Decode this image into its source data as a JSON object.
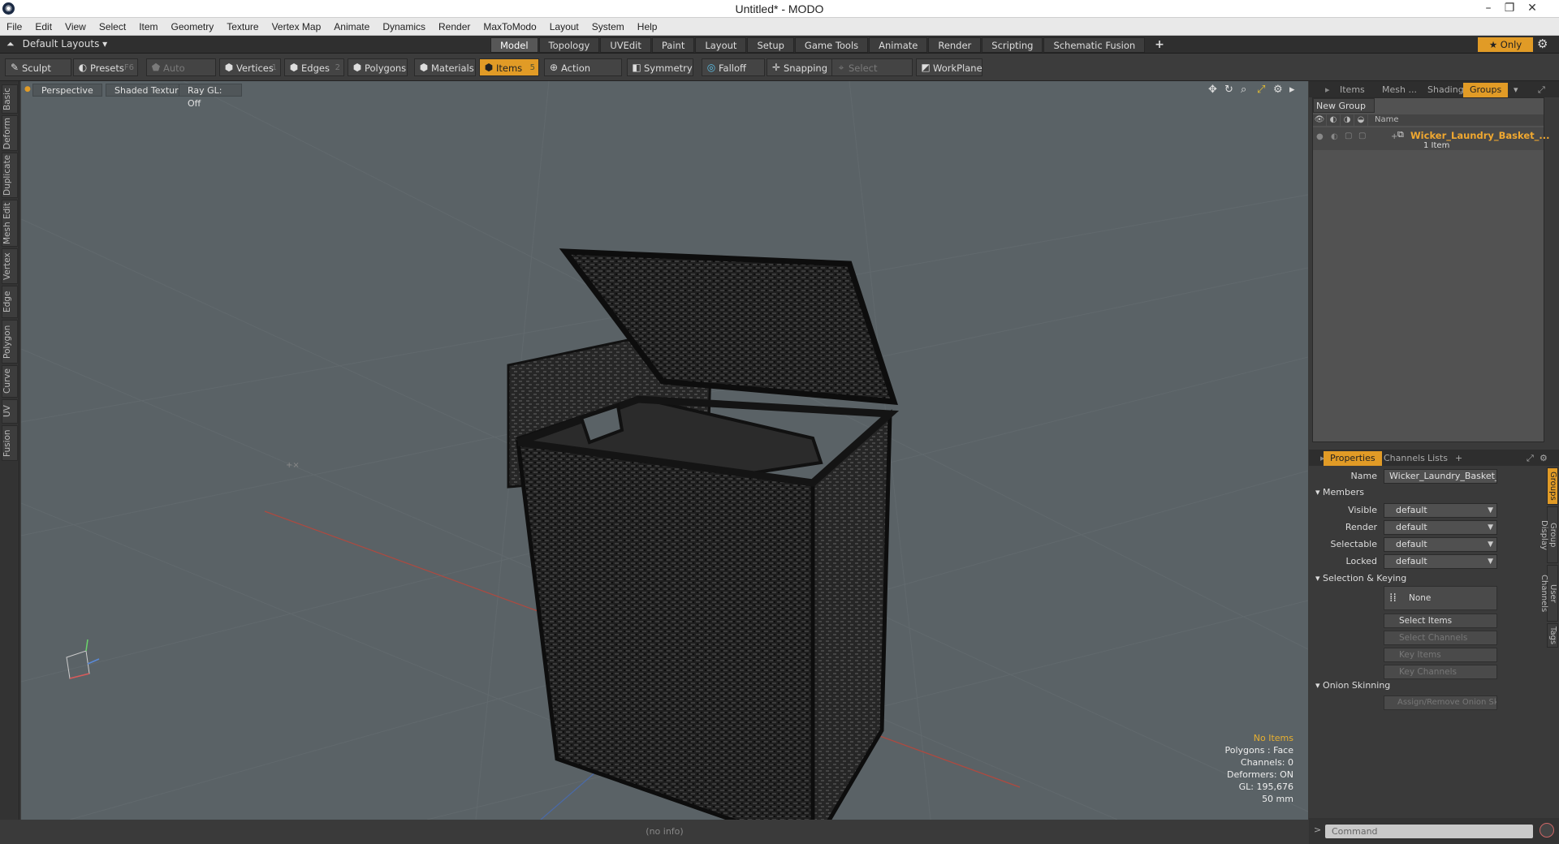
{
  "window": {
    "title": "Untitled* - MODO"
  },
  "menu": [
    "File",
    "Edit",
    "View",
    "Select",
    "Item",
    "Geometry",
    "Texture",
    "Vertex Map",
    "Animate",
    "Dynamics",
    "Render",
    "MaxToModo",
    "Layout",
    "System",
    "Help"
  ],
  "layoutbar": {
    "layout_label": "Default Layouts ▾",
    "tabs": [
      "Model",
      "Topology",
      "UVEdit",
      "Paint",
      "Layout",
      "Setup",
      "Game Tools",
      "Animate",
      "Render",
      "Scripting",
      "Schematic Fusion"
    ],
    "active_tab": "Model",
    "only_label": "★  Only"
  },
  "toolbar": {
    "sculpt": "Sculpt",
    "presets": "Presets",
    "presets_key": "F6",
    "auto_select": "Auto Select",
    "vertices": "Vertices",
    "vertices_key": "1",
    "edges": "Edges",
    "edges_key": "2",
    "polygons": "Polygons",
    "materials": "Materials",
    "items": "Items",
    "items_key": "5",
    "action_center": "Action Center",
    "symmetry": "Symmetry",
    "falloff": "Falloff",
    "snapping": "Snapping",
    "select_through": "Select Through",
    "workplane": "WorkPlane"
  },
  "left_tabs": [
    "Basic",
    "Deform",
    "Duplicate",
    "Mesh Edit",
    "Vertex",
    "Edge",
    "Polygon",
    "Curve",
    "UV",
    "Fusion"
  ],
  "viewport": {
    "perspective": "Perspective",
    "shading": "Shaded Texture",
    "raygl": "Ray GL: Off",
    "info": {
      "no_items": "No Items",
      "polygons": "Polygons : Face",
      "channels": "Channels: 0",
      "deformers": "Deformers: ON",
      "gl": "GL: 195,676",
      "scale": "50 mm"
    },
    "status": "(no info)"
  },
  "groups_panel": {
    "tabs": [
      "Items",
      "Mesh ...",
      "Shading",
      "Groups"
    ],
    "active_tab": "Groups",
    "new_group": "New Group",
    "col_name": "Name",
    "group_name": "Wicker_Laundry_Basket_...",
    "group_count": "1 Item"
  },
  "properties_panel": {
    "tabs": [
      "Properties",
      "Channels",
      "Lists"
    ],
    "active_tab": "Properties",
    "name_label": "Name",
    "name_value": "Wicker_Laundry_Basket_White (:",
    "members_section": "Members",
    "visible_label": "Visible",
    "visible_value": "default",
    "render_label": "Render",
    "render_value": "default",
    "selectable_label": "Selectable",
    "selectable_value": "default",
    "locked_label": "Locked",
    "locked_value": "default",
    "selkey_section": "Selection & Keying",
    "none_btn": "None",
    "select_items": "Select Items",
    "select_channels": "Select Channels",
    "key_items": "Key Items",
    "key_channels": "Key Channels",
    "onion_section": "Onion Skinning",
    "onion_btn": "Assign/Remove Onion Skinn...",
    "side_tabs": [
      "Groups",
      "Group Display",
      "User Channels",
      "Tags"
    ]
  },
  "command": {
    "placeholder": "Command"
  },
  "colors": {
    "accent": "#e19b26",
    "viewport_bg": "#5a6266",
    "group_name": "#f0a830"
  }
}
